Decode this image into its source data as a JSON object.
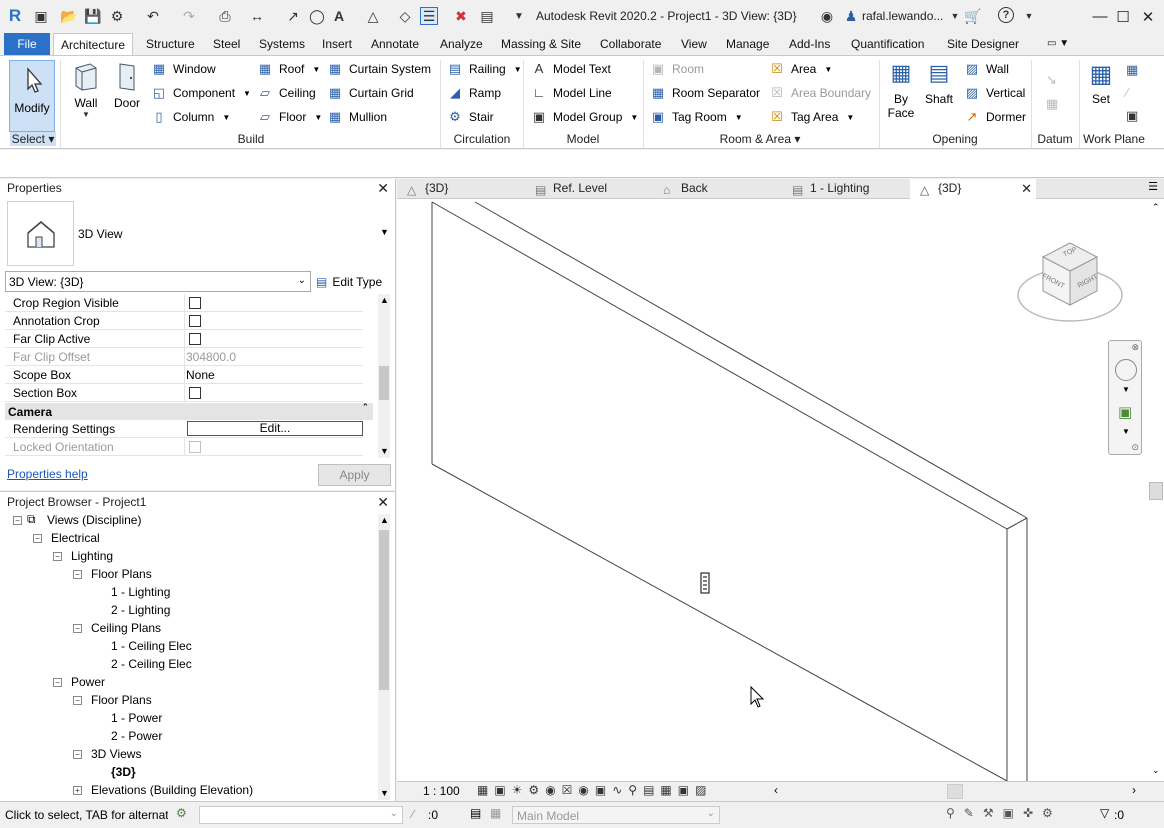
{
  "titlebar": {
    "title": "Autodesk Revit 2020.2 - Project1 - 3D View: {3D}",
    "user": "rafal.lewando...",
    "help_icon": "?",
    "colors": {
      "accent": "#2a71c7"
    }
  },
  "ribbon_tabs": [
    "File",
    "Architecture",
    "Structure",
    "Steel",
    "Systems",
    "Insert",
    "Annotate",
    "Analyze",
    "Massing & Site",
    "Collaborate",
    "View",
    "Manage",
    "Add-Ins",
    "Quantification",
    "Site Designer"
  ],
  "active_tab": "Architecture",
  "ribbon": {
    "select": {
      "modify": "Modify",
      "panel": "Select"
    },
    "build": {
      "panel": "Build",
      "wall": "Wall",
      "door": "Door",
      "window": "Window",
      "component": "Component",
      "column": "Column",
      "roof": "Roof",
      "ceiling": "Ceiling",
      "floor": "Floor",
      "curtain_system": "Curtain System",
      "curtain_grid": "Curtain Grid",
      "mullion": "Mullion"
    },
    "circulation": {
      "panel": "Circulation",
      "railing": "Railing",
      "ramp": "Ramp",
      "stair": "Stair"
    },
    "model": {
      "panel": "Model",
      "model_text": "Model Text",
      "model_line": "Model Line",
      "model_group": "Model Group"
    },
    "room_area": {
      "panel": "Room & Area",
      "room": "Room",
      "room_separator": "Room Separator",
      "tag_room": "Tag Room",
      "area": "Area",
      "area_boundary": "Area Boundary",
      "tag_area": "Tag Area"
    },
    "opening": {
      "panel": "Opening",
      "by_face_1": "By",
      "by_face_2": "Face",
      "shaft": "Shaft",
      "wall": "Wall",
      "vertical": "Vertical",
      "dormer": "Dormer"
    },
    "datum": {
      "panel": "Datum"
    },
    "work_plane": {
      "panel": "Work Plane",
      "set": "Set"
    }
  },
  "properties": {
    "title": "Properties",
    "type_name": "3D View",
    "instance_selector": "3D View: {3D}",
    "edit_type": "Edit Type",
    "rows": [
      {
        "label": "Crop Region Visible",
        "value": "",
        "checkbox": true,
        "disabled": false
      },
      {
        "label": "Annotation Crop",
        "value": "",
        "checkbox": true,
        "disabled": false
      },
      {
        "label": "Far Clip Active",
        "value": "",
        "checkbox": true,
        "disabled": false
      },
      {
        "label": "Far Clip Offset",
        "value": "304800.0",
        "checkbox": false,
        "disabled": true
      },
      {
        "label": "Scope Box",
        "value": "None",
        "checkbox": false,
        "disabled": false
      },
      {
        "label": "Section Box",
        "value": "",
        "checkbox": true,
        "disabled": false
      }
    ],
    "group_camera": "Camera",
    "rendering_settings": "Rendering Settings",
    "edit_button": "Edit...",
    "locked_orientation": "Locked Orientation",
    "help_link": "Properties help",
    "apply": "Apply"
  },
  "browser": {
    "title": "Project Browser - Project1",
    "nodes": [
      {
        "label": "Views (Discipline)",
        "depth": 0,
        "toggle": "-"
      },
      {
        "label": "Electrical",
        "depth": 1,
        "toggle": "-"
      },
      {
        "label": "Lighting",
        "depth": 2,
        "toggle": "-"
      },
      {
        "label": "Floor Plans",
        "depth": 3,
        "toggle": "-"
      },
      {
        "label": "1 - Lighting",
        "depth": 4,
        "toggle": ""
      },
      {
        "label": "2 - Lighting",
        "depth": 4,
        "toggle": ""
      },
      {
        "label": "Ceiling Plans",
        "depth": 3,
        "toggle": "-"
      },
      {
        "label": "1 - Ceiling Elec",
        "depth": 4,
        "toggle": ""
      },
      {
        "label": "2 - Ceiling Elec",
        "depth": 4,
        "toggle": ""
      },
      {
        "label": "Power",
        "depth": 2,
        "toggle": "-"
      },
      {
        "label": "Floor Plans",
        "depth": 3,
        "toggle": "-"
      },
      {
        "label": "1 - Power",
        "depth": 4,
        "toggle": ""
      },
      {
        "label": "2 - Power",
        "depth": 4,
        "toggle": ""
      },
      {
        "label": "3D Views",
        "depth": 3,
        "toggle": "-"
      },
      {
        "label": "{3D}",
        "depth": 4,
        "toggle": "",
        "bold": true
      },
      {
        "label": "Elevations (Building Elevation)",
        "depth": 3,
        "toggle": "+"
      }
    ]
  },
  "view_tabs": [
    {
      "label": "{3D}",
      "icon": "3d-view-icon",
      "active": false
    },
    {
      "label": "Ref. Level",
      "icon": "plan-view-icon",
      "active": false
    },
    {
      "label": "Back",
      "icon": "elevation-icon",
      "active": false
    },
    {
      "label": "1 - Lighting",
      "icon": "plan-view-icon",
      "active": false
    },
    {
      "label": "{3D}",
      "icon": "3d-view-icon",
      "active": true
    }
  ],
  "viewcube": {
    "top": "TOP",
    "front": "FRONT",
    "right": "RIGHT"
  },
  "view_control": {
    "scale": "1 : 100"
  },
  "status": {
    "message": "Click to select, TAB for alternate",
    "workset_count": ":0",
    "design_option": "Main Model",
    "filter_count": ":0"
  }
}
